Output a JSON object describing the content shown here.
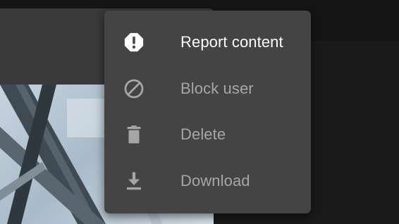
{
  "menu": {
    "items": [
      {
        "label": "Report content",
        "icon": "alert-octagon-icon",
        "state": "active"
      },
      {
        "label": "Block user",
        "icon": "block-icon",
        "state": "muted"
      },
      {
        "label": "Delete",
        "icon": "trash-icon",
        "state": "muted"
      },
      {
        "label": "Download",
        "icon": "download-icon",
        "state": "muted"
      }
    ]
  },
  "colors": {
    "menu_background": "#444444",
    "active_text": "#ffffff",
    "muted_text": "#a6a6a6",
    "page_background": "#1c1c1c"
  }
}
